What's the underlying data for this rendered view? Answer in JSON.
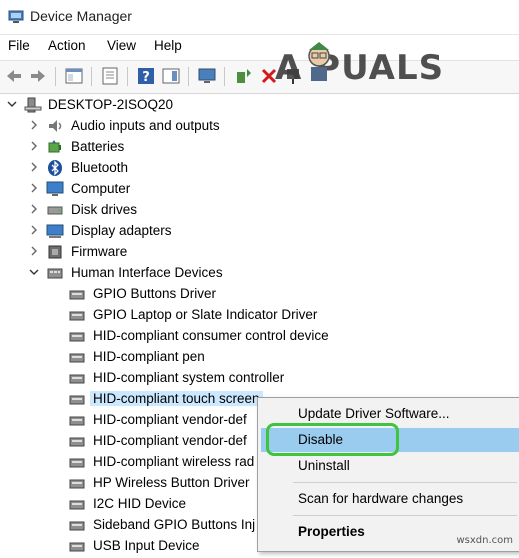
{
  "window": {
    "title": "Device Manager"
  },
  "menu": [
    "File",
    "Action",
    "View",
    "Help"
  ],
  "watermark": {
    "text": "A  PUALS"
  },
  "site_mark": "wsxdn.com",
  "tree": {
    "root": "DESKTOP-2ISOQ20",
    "categories": [
      {
        "label": "Audio inputs and outputs",
        "icon": "speaker-icon"
      },
      {
        "label": "Batteries",
        "icon": "battery-icon"
      },
      {
        "label": "Bluetooth",
        "icon": "bluetooth-icon"
      },
      {
        "label": "Computer",
        "icon": "computer-icon"
      },
      {
        "label": "Disk drives",
        "icon": "disk-drive-icon"
      },
      {
        "label": "Display adapters",
        "icon": "display-adapter-icon"
      },
      {
        "label": "Firmware",
        "icon": "firmware-icon"
      },
      {
        "label": "Human Interface Devices",
        "icon": "hid-icon",
        "expanded": true
      }
    ],
    "hid_children": [
      "GPIO Buttons Driver",
      "GPIO Laptop or Slate Indicator Driver",
      "HID-compliant consumer control device",
      "HID-compliant pen",
      "HID-compliant system controller",
      "HID-compliant touch screen",
      "HID-compliant vendor-def",
      "HID-compliant vendor-def",
      "HID-compliant wireless rad",
      "HP Wireless Button Driver",
      "I2C HID Device",
      "Sideband GPIO Buttons Inj",
      "USB Input Device"
    ],
    "selected_index": 5
  },
  "context_menu": {
    "items": [
      "Update Driver Software...",
      "Disable",
      "Uninstall",
      "Scan for hardware changes",
      "Properties"
    ],
    "highlighted": "Disable",
    "highlight_color": "#99ccee",
    "ring_color": "#3ec43e"
  }
}
